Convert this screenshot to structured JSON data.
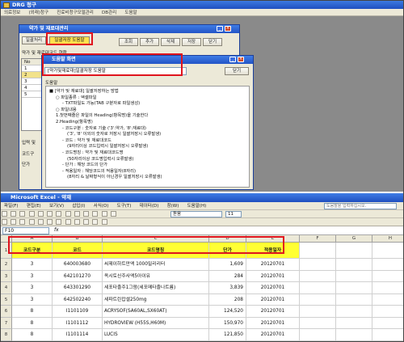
{
  "app": {
    "title": "DRG 청구",
    "menu": [
      "의료정보",
      "(외래)청구",
      "진료비청구모델관리",
      "DB관리",
      "도움말"
    ]
  },
  "drug_window": {
    "title": "약가 및 재료대관리",
    "tab_labels": [
      "일괄처리",
      "일괄저장 도움말"
    ],
    "toolbar": [
      "조회",
      "추가",
      "삭제",
      "저장",
      "닫기"
    ],
    "grid_label": "약가 및 재료대코드 현황",
    "grid_header": "No",
    "grid_rows": [
      "1",
      "2",
      "3",
      "4",
      "5"
    ],
    "bottom_labels": [
      "입력 및",
      "코드구",
      "단가"
    ]
  },
  "help_window": {
    "title": "도움말 화면",
    "combo_value": "[약가및재료대]일괄저장 도움말",
    "close_label": "닫기",
    "content_label": "도움말",
    "lines": [
      "■ [약가 및 재료대] 일괄저장하는 방법",
      "○ 파일종류 : 엑셀파일",
      "- TXT파일도 가능(TAB 구분자로 파일생성)",
      "○ 파일내용",
      "1.첫번째줄은 파일의 Heading(항목명)을 기술한다",
      "2.Heading(항목명)",
      "- 코드구분 : 숫자로 기술 ('3':약가, '8':재료대)",
      "('3', '8' 이외의 숫자로 저장시 일괄저장시 오류발생)",
      "- 코드 : 약가 및 재료대코드",
      "(9자리이상 코드입력시 일괄저장시 오류발생)",
      "- 코드명칭 : 약가 및 재료대코드명",
      "(50자리이상 코드명입력시 오류발생)",
      "- 단가 : 해당 코드의 단가",
      "- 적용일자 : 해당코드의 적용일자(8자리)",
      "(8자리 & 날짜형식이 아닌경우 일괄저장시 오류발생)"
    ]
  },
  "excel": {
    "title": "Microsoft Excel - 약재",
    "menu": [
      "파일(F)",
      "편집(E)",
      "보기(V)",
      "삽입(I)",
      "서식(O)",
      "도구(T)",
      "데이터(D)",
      "창(W)",
      "도움말(H)"
    ],
    "help_placeholder": "도움말을 입력하십시오.",
    "font_name": "돋움",
    "font_size": "11",
    "name_box": "F10",
    "fx": "fx",
    "columns": [
      "A",
      "B",
      "C",
      "D",
      "E",
      "F",
      "G",
      "H",
      "I"
    ],
    "header_row": [
      "코드구분",
      "코드",
      "코드명칭",
      "단가",
      "적용일자"
    ],
    "rows": [
      [
        "3",
        "640003680",
        "씨제이하트만액 1000밀리리터",
        "1,609",
        "20120701"
      ],
      [
        "3",
        "642101270",
        "옥시토신주사액5아이유",
        "284",
        "20120701"
      ],
      [
        "3",
        "643301290",
        "세포타졸주1그람(세포메타졸나트륨)",
        "3,839",
        "20120701"
      ],
      [
        "3",
        "642502240",
        "세파트린캅셀250mg",
        "208",
        "20120701"
      ],
      [
        "8",
        "I1101109",
        "ACRYSOF(SA60AL,SX60AT)",
        "124,520",
        "20120701"
      ],
      [
        "8",
        "I1101112",
        "HYDROVIEW (H55S,H60M)",
        "150,970",
        "20120701"
      ],
      [
        "8",
        "I1101114",
        "LUCIS",
        "121,850",
        "20120701"
      ]
    ]
  }
}
